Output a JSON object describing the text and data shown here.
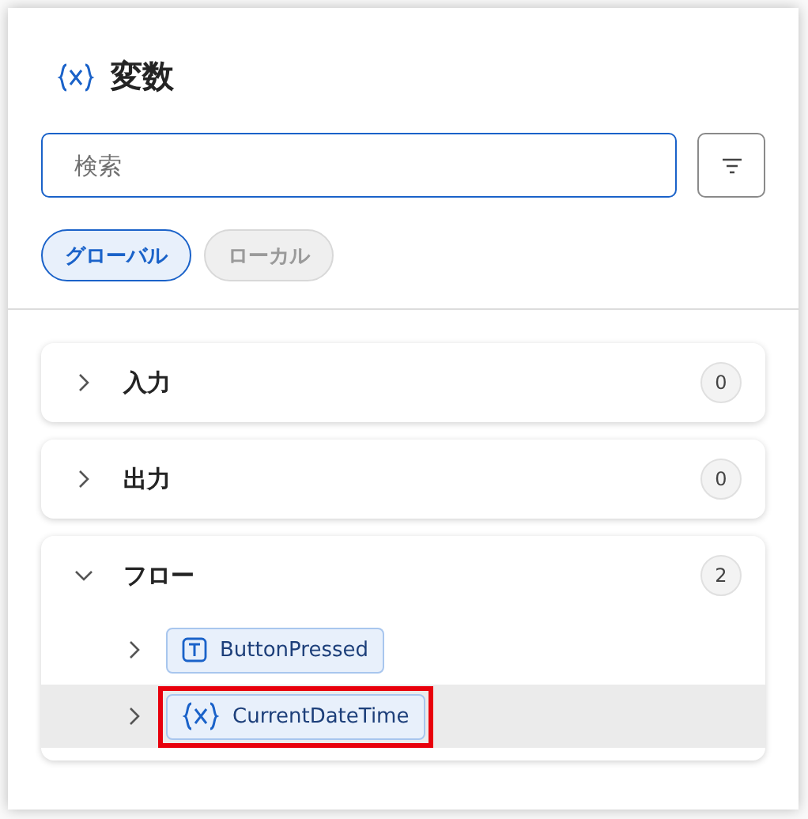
{
  "panel": {
    "title": "変数"
  },
  "search": {
    "placeholder": "検索"
  },
  "scope_tabs": [
    {
      "label": "グローバル",
      "selected": true
    },
    {
      "label": "ローカル",
      "selected": false
    }
  ],
  "groups": [
    {
      "label": "入力",
      "count": "0",
      "expanded": false
    },
    {
      "label": "出力",
      "count": "0",
      "expanded": false
    },
    {
      "label": "フロー",
      "count": "2",
      "expanded": true,
      "items": [
        {
          "name": "ButtonPressed",
          "kind": "text",
          "expanded": false,
          "selected": false,
          "highlighted": false
        },
        {
          "name": "CurrentDateTime",
          "kind": "variable",
          "expanded": false,
          "selected": true,
          "highlighted": true
        }
      ]
    }
  ]
}
